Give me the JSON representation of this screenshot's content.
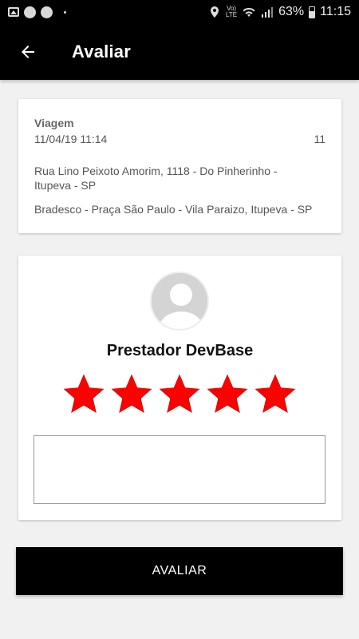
{
  "status_bar": {
    "icons": [
      "photo-icon",
      "notification-dot",
      "notification-dot",
      "mini-dot",
      "location-icon",
      "volte-icon",
      "wifi-icon",
      "signal-icon",
      "battery-icon"
    ],
    "volte_top": "Vo)",
    "volte_bottom": "LTE",
    "battery_percent": "63%",
    "time": "11:15"
  },
  "app_bar": {
    "title": "Avaliar",
    "back_icon": "arrow-left-icon"
  },
  "trip": {
    "label": "Viagem",
    "datetime": "11/04/19 11:14",
    "number": "11",
    "origin": "Rua Lino Peixoto Amorim, 1118 - Do Pinherinho - Itupeva - SP",
    "destination": "Bradesco - Praça São Paulo - Vila Paraizo, Itupeva - SP"
  },
  "rating": {
    "avatar_icon": "user-avatar-icon",
    "provider_name": "Prestador DevBase",
    "stars_selected": 5,
    "stars_total": 5,
    "star_color": "#ff0000",
    "comment_value": ""
  },
  "submit": {
    "label": "AVALIAR"
  },
  "colors": {
    "app_bar": "#000000",
    "background": "#f2f1f2",
    "card": "#ffffff"
  }
}
